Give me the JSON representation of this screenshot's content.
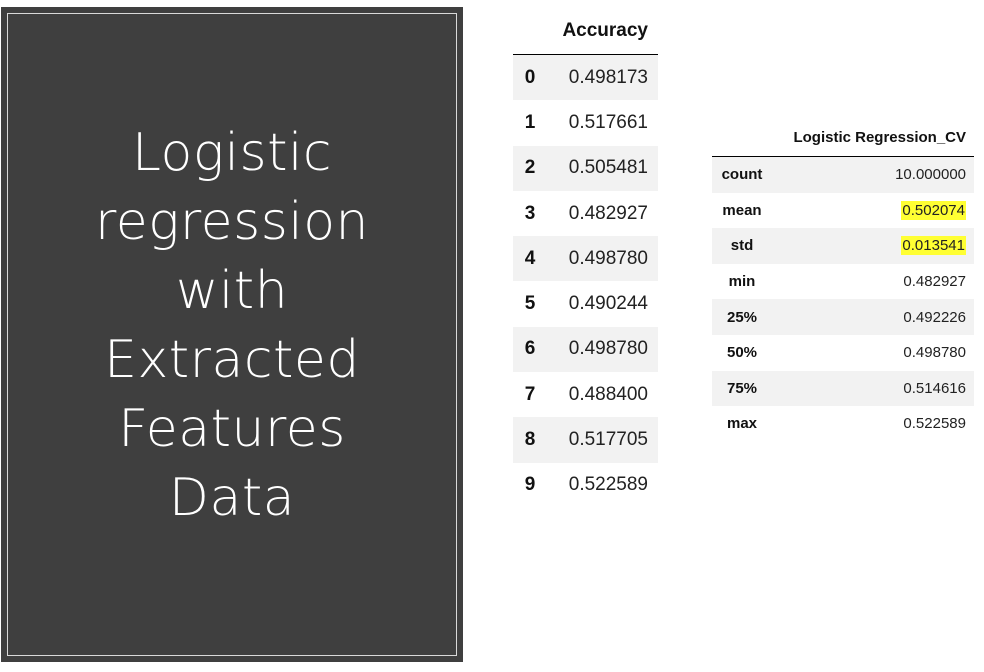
{
  "slide": {
    "title_lines": [
      "Logistic",
      "regression",
      "with",
      "Extracted",
      "Features",
      "Data"
    ]
  },
  "accuracy_table": {
    "header": "Accuracy",
    "rows": [
      {
        "index": "0",
        "value": "0.498173"
      },
      {
        "index": "1",
        "value": "0.517661"
      },
      {
        "index": "2",
        "value": "0.505481"
      },
      {
        "index": "3",
        "value": "0.482927"
      },
      {
        "index": "4",
        "value": "0.498780"
      },
      {
        "index": "5",
        "value": "0.490244"
      },
      {
        "index": "6",
        "value": "0.498780"
      },
      {
        "index": "7",
        "value": "0.488400"
      },
      {
        "index": "8",
        "value": "0.517705"
      },
      {
        "index": "9",
        "value": "0.522589"
      }
    ]
  },
  "summary_table": {
    "header": "Logistic Regression_CV",
    "rows": [
      {
        "stat": "count",
        "value": "10.000000",
        "highlighted": false
      },
      {
        "stat": "mean",
        "value": "0.502074",
        "highlighted": true
      },
      {
        "stat": "std",
        "value": "0.013541",
        "highlighted": true
      },
      {
        "stat": "min",
        "value": "0.482927",
        "highlighted": false
      },
      {
        "stat": "25%",
        "value": "0.492226",
        "highlighted": false
      },
      {
        "stat": "50%",
        "value": "0.498780",
        "highlighted": false
      },
      {
        "stat": "75%",
        "value": "0.514616",
        "highlighted": false
      },
      {
        "stat": "max",
        "value": "0.522589",
        "highlighted": false
      }
    ]
  },
  "colors": {
    "panel_background": "#3f3f3f",
    "highlight": "#ffff33",
    "stripe": "#f2f2f2"
  }
}
